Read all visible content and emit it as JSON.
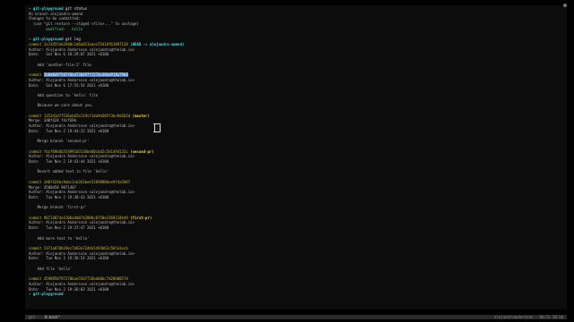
{
  "terminal": {
    "lines": [
      {
        "kind": "prompt",
        "repo": "git-playground",
        "cmd": "git status"
      },
      {
        "kind": "text",
        "text": "On branch alejandro-amend",
        "cls": "meta"
      },
      {
        "kind": "text",
        "text": "Changes to be committed:",
        "cls": "meta"
      },
      {
        "kind": "text",
        "text": "  (use \"git restore --staged <file>...\" to unstage)",
        "cls": "meta"
      },
      {
        "kind": "text",
        "text": "\tmodified:   hello",
        "cls": "file"
      },
      {
        "kind": "blank"
      },
      {
        "kind": "prompt",
        "repo": "git-playground",
        "cmd": "git log"
      },
      {
        "kind": "commit",
        "sha": "2a74d55eb2940c1d6a013aaec55d10f61097138",
        "ref": "(HEAD -> alejandro-amend)"
      },
      {
        "kind": "text",
        "text": "Author: Alejandro Andersson <alejandro@thelab.io>",
        "cls": "meta"
      },
      {
        "kind": "text",
        "text": "Date:   Sat Nov 6 18:29:07 2021 +0100",
        "cls": "meta"
      },
      {
        "kind": "blank"
      },
      {
        "kind": "text",
        "text": "    Add 'another-file-2' file",
        "cls": "msg"
      },
      {
        "kind": "blank"
      },
      {
        "kind": "commit",
        "sha": "2b0d8d97587f6b4730497f2570cd8bd918a79b0",
        "ref": "",
        "selected": true
      },
      {
        "kind": "text",
        "text": "Author: Alejandro Andersson <alejandro@thelab.io>",
        "cls": "meta"
      },
      {
        "kind": "text",
        "text": "Date:   Sat Nov 6 17:55:54 2021 +0100",
        "cls": "meta"
      },
      {
        "kind": "blank"
      },
      {
        "kind": "text",
        "text": "    Add question to 'hello' file",
        "cls": "msg"
      },
      {
        "kind": "blank"
      },
      {
        "kind": "text",
        "text": "    Because we care about you.",
        "cls": "msg"
      },
      {
        "kind": "blank"
      },
      {
        "kind": "commit",
        "sha": "1353d1d7f536ebb5e119cf1da9d385f3bc9d2b5d",
        "ref": "(master)"
      },
      {
        "kind": "text",
        "text": "Merge: 3d0f424 fdcf69b",
        "cls": "meta"
      },
      {
        "kind": "text",
        "text": "Author: Alejandro Andersson <alejandro@thelab.io>",
        "cls": "meta"
      },
      {
        "kind": "text",
        "text": "Date:   Tue Nov 2 19:44:22 2021 +0100",
        "cls": "meta"
      },
      {
        "kind": "blank"
      },
      {
        "kind": "text",
        "text": "    Merge branch 'second-pr'",
        "cls": "msg"
      },
      {
        "kind": "blank"
      },
      {
        "kind": "commit",
        "sha": "fdcf69b6b55499103136bdd0cbd2c5b1494132c",
        "ref": "(second-pr)"
      },
      {
        "kind": "text",
        "text": "Author: Alejandro Andersson <alejandro@thelab.io>",
        "cls": "meta"
      },
      {
        "kind": "text",
        "text": "Date:   Tue Nov 2 19:43:44 2021 +0100",
        "cls": "meta"
      },
      {
        "kind": "blank"
      },
      {
        "kind": "text",
        "text": "    Revert added text in file 'hello'",
        "cls": "msg"
      },
      {
        "kind": "blank"
      },
      {
        "kind": "commit",
        "sha": "3d0f424bc9abc1cb263bee5269880bee9f4a5067",
        "ref": ""
      },
      {
        "kind": "text",
        "text": "Merge: 4500d50 9071407",
        "cls": "meta"
      },
      {
        "kind": "text",
        "text": "Author: Alejandro Andersson <alejandro@thelab.io>",
        "cls": "meta"
      },
      {
        "kind": "text",
        "text": "Date:   Tue Nov 2 19:38:43 2021 +0100",
        "cls": "meta"
      },
      {
        "kind": "blank"
      },
      {
        "kind": "text",
        "text": "    Merge branch 'first-pr'",
        "cls": "msg"
      },
      {
        "kind": "blank"
      },
      {
        "kind": "commit",
        "sha": "90714074e4106add0742806c0750e2369234b49",
        "ref": "(first-pr)"
      },
      {
        "kind": "text",
        "text": "Author: Alejandro Andersson <alejandro@thelab.io>",
        "cls": "meta"
      },
      {
        "kind": "text",
        "text": "Date:   Tue Nov 2 19:37:47 2021 +0100",
        "cls": "meta"
      },
      {
        "kind": "blank"
      },
      {
        "kind": "text",
        "text": "    Add more text to 'hello'",
        "cls": "msg"
      },
      {
        "kind": "blank"
      },
      {
        "kind": "commit",
        "sha": "5371a070b19ec7b83e72d4e5493b62c5b5a1ecb",
        "ref": ""
      },
      {
        "kind": "text",
        "text": "Author: Alejandro Andersson <alejandro@thelab.io>",
        "cls": "meta"
      },
      {
        "kind": "text",
        "text": "Date:   Tue Nov 2 19:36:54 2021 +0100",
        "cls": "meta"
      },
      {
        "kind": "blank"
      },
      {
        "kind": "text",
        "text": "    Add file 'hello'",
        "cls": "msg"
      },
      {
        "kind": "blank"
      },
      {
        "kind": "commit",
        "sha": "4590958797270bae5507726bdb0bc7d28600574",
        "ref": ""
      },
      {
        "kind": "text",
        "text": "Author: Alejandro Andersson <alejandro@thelab.io>",
        "cls": "meta"
      },
      {
        "kind": "text",
        "text": "Date:   Tue Nov 2 19:36:03 2021 +0100",
        "cls": "meta"
      },
      {
        "kind": "prompt",
        "repo": "git-playground",
        "cmd": ""
      }
    ]
  },
  "statusbar": {
    "left": "git",
    "window": "0:bash*",
    "right": "alejandroandersson · 06/11 18:30"
  },
  "colors": {
    "background": "#0c0c0c",
    "prompt_arrow": "#3fd16b",
    "repo": "#4fd9d9",
    "sha": "#c9b83a",
    "selection": "#3a7ad0"
  }
}
